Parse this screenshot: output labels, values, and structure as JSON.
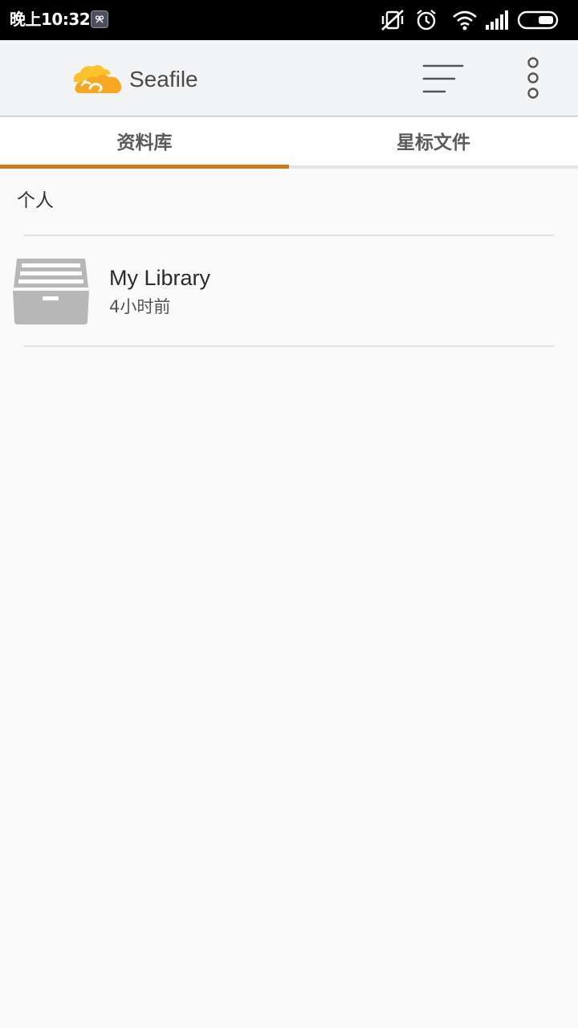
{
  "status_bar": {
    "time": "晚上10:32",
    "icons": [
      "notification-app-icon",
      "vibrate-off-icon",
      "alarm-icon",
      "wifi-icon",
      "signal-icon",
      "battery-icon"
    ]
  },
  "app_bar": {
    "title": "Seafile",
    "logo_icon": "seafile-cloud-logo",
    "accent_color": "#f7a823"
  },
  "tabs": [
    {
      "label": "资料库",
      "selected": true
    },
    {
      "label": "星标文件",
      "selected": false
    }
  ],
  "tab_indicator_color": "#d0781a",
  "sections": [
    {
      "header": "个人",
      "items": [
        {
          "name": "My Library",
          "modified": "4小时前",
          "icon": "library-cabinet-icon"
        }
      ]
    }
  ]
}
